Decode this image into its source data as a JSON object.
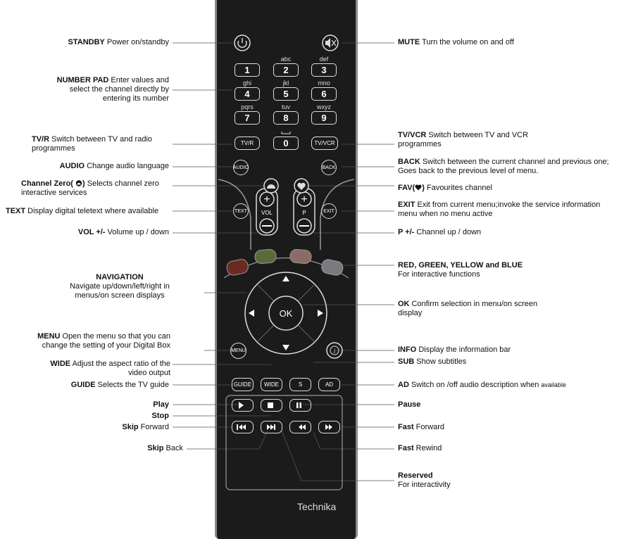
{
  "left_labels": [
    {
      "id": "standby",
      "title": "STANDBY",
      "text": " Power on/standby"
    },
    {
      "id": "number_pad",
      "title": "NUMBER PAD",
      "text": " Enter values and select the channel directly by entering its number"
    },
    {
      "id": "tvr",
      "title": "TV/R",
      "text": " Switch between TV and radio programmes"
    },
    {
      "id": "audio",
      "title": "AUDIO",
      "text": " Change audio language"
    },
    {
      "id": "channel_zero",
      "title": "Channel Zero(",
      "title2": ")",
      "text": " Selects channel zero interactive services"
    },
    {
      "id": "text",
      "title": "TEXT",
      "text": " Display digital teletext where available"
    },
    {
      "id": "vol",
      "title": "VOL +/-",
      "text": " Volume up / down"
    },
    {
      "id": "navigation",
      "title": "NAVIGATION",
      "text": "Navigate up/down/left/right in menus/on screen displays"
    },
    {
      "id": "menu",
      "title": "MENU",
      "text": " Open the menu so that you can change the setting of your Digital Box"
    },
    {
      "id": "wide",
      "title": "WIDE",
      "text": " Adjust the aspect ratio of the video output"
    },
    {
      "id": "guide",
      "title": "GUIDE",
      "text": " Selects the TV guide"
    },
    {
      "id": "play",
      "title": "Play",
      "text": ""
    },
    {
      "id": "stop",
      "title": "Stop",
      "text": ""
    },
    {
      "id": "skip_fwd",
      "title": "Skip",
      "text": " Forward"
    },
    {
      "id": "skip_back",
      "title": "Skip",
      "text": " Back"
    }
  ],
  "right_labels": [
    {
      "id": "mute",
      "title": "MUTE",
      "text": " Turn the volume on and off"
    },
    {
      "id": "tvvcr",
      "title": "TV/VCR",
      "text": " Switch between TV and VCR programmes"
    },
    {
      "id": "back",
      "title": "BACK",
      "text": " Switch between the current channel and previous one; Goes back to the previous level of menu."
    },
    {
      "id": "fav",
      "title": "FAV(",
      "title2": ")",
      "text": " Favourites channel"
    },
    {
      "id": "exit",
      "title": "EXIT",
      "text": " Exit from current menu;invoke the service information menu when no menu active"
    },
    {
      "id": "p",
      "title": "P +/-",
      "text": " Channel up / down"
    },
    {
      "id": "colors",
      "title": "RED, GREEN, YELLOW and BLUE",
      "text": "For interactive functions"
    },
    {
      "id": "ok",
      "title": "OK",
      "text": " Confirm selection in menu/on screen display"
    },
    {
      "id": "info",
      "title": "INFO",
      "text": " Display the information bar"
    },
    {
      "id": "sub",
      "title": "SUB",
      "text": " Show subtitles"
    },
    {
      "id": "ad",
      "title": "AD",
      "text": " Switch on /off audio description when ",
      "small": "available"
    },
    {
      "id": "pause",
      "title": "Pause",
      "text": ""
    },
    {
      "id": "fast_fwd",
      "title": "Fast",
      "text": " Forward"
    },
    {
      "id": "fast_rew",
      "title": "Fast",
      "text": " Rewind"
    },
    {
      "id": "reserved",
      "title": "Reserved",
      "text": "For interactivity"
    }
  ],
  "remote": {
    "brand": "Technika",
    "keys": {
      "1": "1",
      "2": "2",
      "3": "3",
      "4": "4",
      "5": "5",
      "6": "6",
      "7": "7",
      "8": "8",
      "9": "9",
      "0": "0"
    },
    "subs": {
      "abc": "abc",
      "def": "def",
      "ghi": "ghi",
      "jkl": "jkl",
      "mno": "mno",
      "pqrs": "pqrs",
      "tuv": "tuv",
      "wxyz": "wxyz"
    },
    "tvr": "TV/R",
    "tvvcr": "TV/VCR",
    "audio": "AUDIO",
    "back": "BACK",
    "text": "TEXT",
    "exit": "EXIT",
    "vol": "VOL",
    "p": "P",
    "ok": "OK",
    "menu": "MENU",
    "guide": "GUIDE",
    "wide": "WIDE",
    "s": "S",
    "ad": "AD"
  },
  "colors": {
    "red": "#6a2a22",
    "green": "#5b6a3b",
    "yellow": "#8a6b66",
    "blue": "#7a7a80"
  }
}
